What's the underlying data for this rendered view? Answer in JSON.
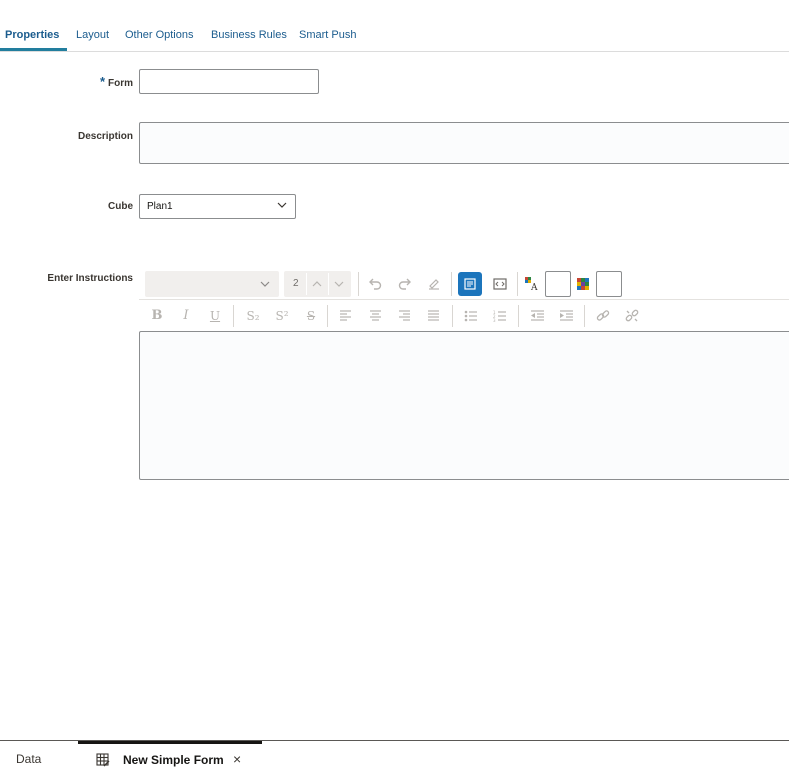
{
  "tabs": [
    {
      "label": "Properties"
    },
    {
      "label": "Layout"
    },
    {
      "label": "Other Options"
    },
    {
      "label": "Business Rules"
    },
    {
      "label": "Smart Push"
    }
  ],
  "form": {
    "form_label": "Form",
    "required_marker": "*",
    "form_value": "",
    "description_label": "Description",
    "description_value": "",
    "cube_label": "Cube",
    "cube_value": "Plan1",
    "instructions_label": "Enter Instructions",
    "font_size_value": "2"
  },
  "toolbar": {
    "bold": "B",
    "italic": "I",
    "underline": "U",
    "subscript": "S₂",
    "superscript": "S²",
    "strikethrough": "S"
  },
  "bottom": {
    "data_tab": "Data",
    "active_tab": "New Simple Form",
    "close_glyph": "×"
  },
  "colors": {
    "accent": "#1b5c8e",
    "active_button": "#1c75bc"
  }
}
